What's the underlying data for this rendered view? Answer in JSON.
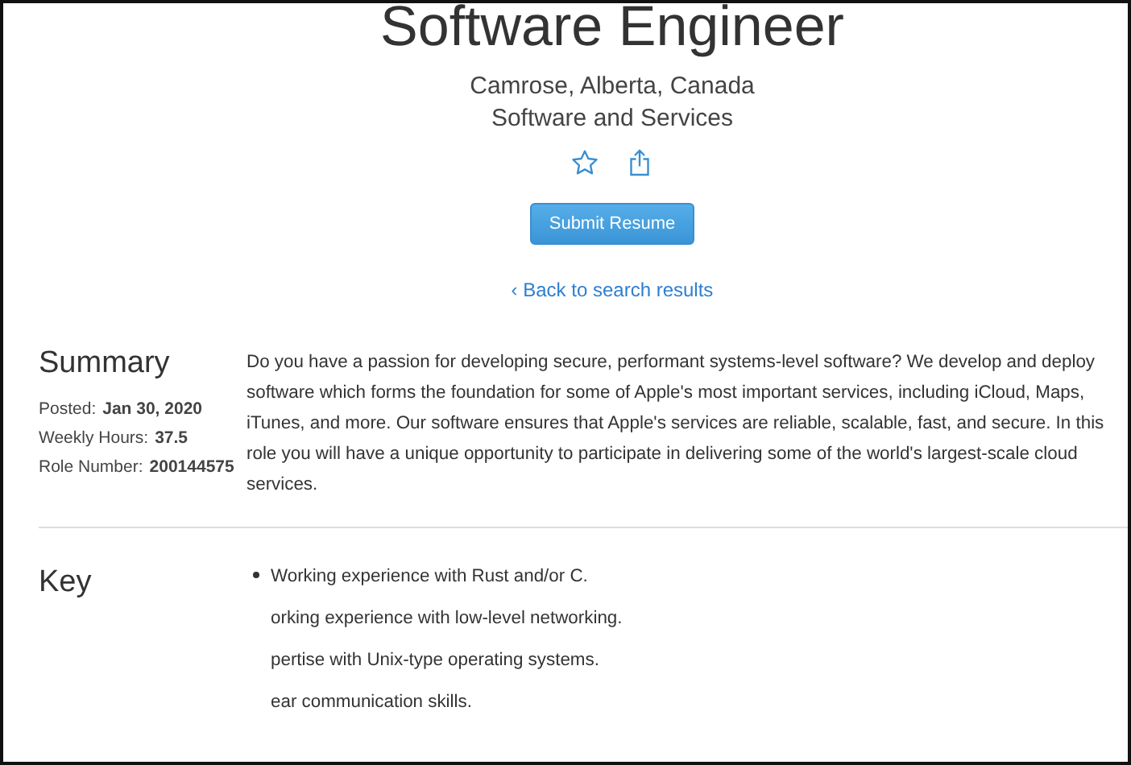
{
  "header": {
    "title": "Software Engineer",
    "location": "Camrose, Alberta, Canada",
    "team": "Software and Services",
    "favorite": false,
    "submit_button": "Submit Resume",
    "back_link": "‹ Back to search results"
  },
  "summary": {
    "heading": "Summary",
    "meta": [
      {
        "label": "Posted:",
        "value": "Jan 30, 2020"
      },
      {
        "label": "Weekly Hours:",
        "value": "37.5"
      },
      {
        "label": "Role Number:",
        "value": "200144575"
      }
    ],
    "text": "Do you have a passion for developing secure, performant systems-level software? We develop and deploy software which forms the foundation for some of Apple's most important services, including iCloud, Maps, iTunes, and more. Our software ensures that Apple's services are reliable, scalable, fast, and secure. In this role you will have a unique opportunity to participate in delivering some of the world's largest-scale cloud services."
  },
  "qualifications": {
    "heading": "Key",
    "items": [
      {
        "text": "Working experience with Rust and/or C.",
        "bullet": true
      },
      {
        "text": "orking experience with low-level networking.",
        "bullet": false
      },
      {
        "text": "pertise with Unix-type operating systems.",
        "bullet": false
      },
      {
        "text": "ear communication skills.",
        "bullet": false
      }
    ]
  }
}
